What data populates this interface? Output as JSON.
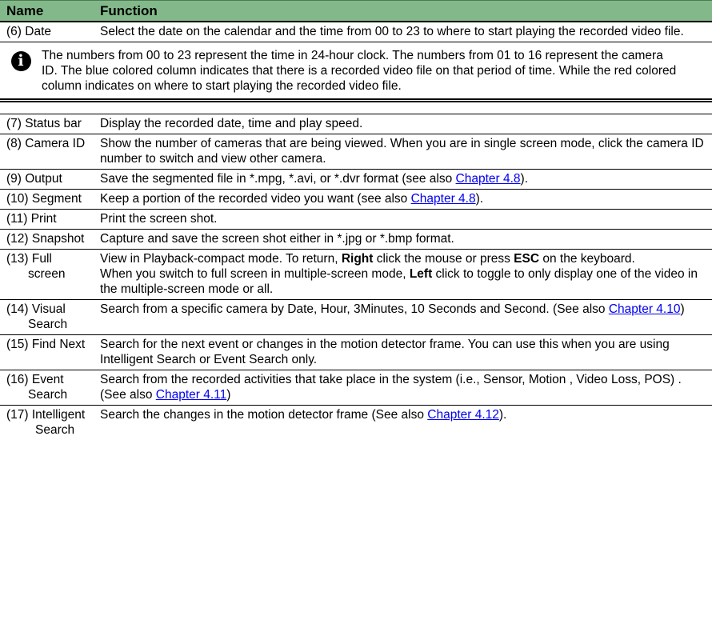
{
  "header": {
    "name": "Name",
    "function": "Function"
  },
  "row6": {
    "name": "(6) Date",
    "desc": "Select the date on the calendar and the time from 00 to 23 to where to start playing the recorded video file."
  },
  "note": {
    "icon": "info-icon",
    "glyph": "i",
    "text": "The numbers from 00 to 23 represent the time in 24-hour clock. The numbers from 01 to 16 represent the camera ID. The blue colored column indicates that there is a recorded video file on that period of time. While the red colored column indicates on where to start playing the recorded video file."
  },
  "row7": {
    "name": "(7) Status bar",
    "desc": "Display the recorded date, time and play speed."
  },
  "row8": {
    "name": "(8) Camera ID",
    "desc": "Show the number of cameras that are being viewed. When you are in single screen mode, click the camera ID number to switch and view other camera."
  },
  "row9": {
    "name": "(9) Output",
    "desc": "Save the segmented file in *.mpg, *.avi, or *.dvr format (see also ",
    "link": "Chapter 4.8",
    "end": ")."
  },
  "row10": {
    "name": "(10) Segment",
    "desc": "Keep a portion of the recorded video you want (see also ",
    "link": "Chapter 4.8",
    "end": ")."
  },
  "row11": {
    "name": "(11) Print",
    "desc": "Print the screen shot."
  },
  "row12": {
    "name": "(12) Snapshot",
    "desc": "Capture and save the screen shot either in *.jpg or *.bmp format."
  },
  "row13": {
    "name1": "(13) Full",
    "name2": "screen",
    "d1": "View in Playback-compact mode. To return, ",
    "b1": "Right",
    "d2": " click the mouse or press ",
    "b2": "ESC",
    "d3": " on the keyboard.",
    "d4": "When you switch to full screen in multiple-screen mode, ",
    "b3": "Left",
    "d5": " click to toggle to only display one of the video in the multiple-screen mode or all."
  },
  "row14": {
    "name1": "(14) Visual",
    "name2": "Search",
    "desc": "Search from a specific camera by Date, Hour, 3Minutes, 10 Seconds and Second. (See also ",
    "link": "Chapter 4.10",
    "end": ")"
  },
  "row15": {
    "name": "(15) Find Next",
    "desc": "Search for the next event or changes in the motion detector frame. You can use this when you are using Intelligent Search or Event Search only."
  },
  "row16": {
    "name1": "(16) Event",
    "name2": "Search",
    "desc": "Search from the recorded activities that take place in the system (i.e., Sensor, Motion , Video Loss, POS) . (See also ",
    "link": "Chapter 4.11",
    "end": ")"
  },
  "row17": {
    "name1": "(17) Intelligent",
    "name2": "Search",
    "desc": "Search the changes in the motion detector frame (See also ",
    "link": "Chapter 4.12",
    "end": ")."
  }
}
